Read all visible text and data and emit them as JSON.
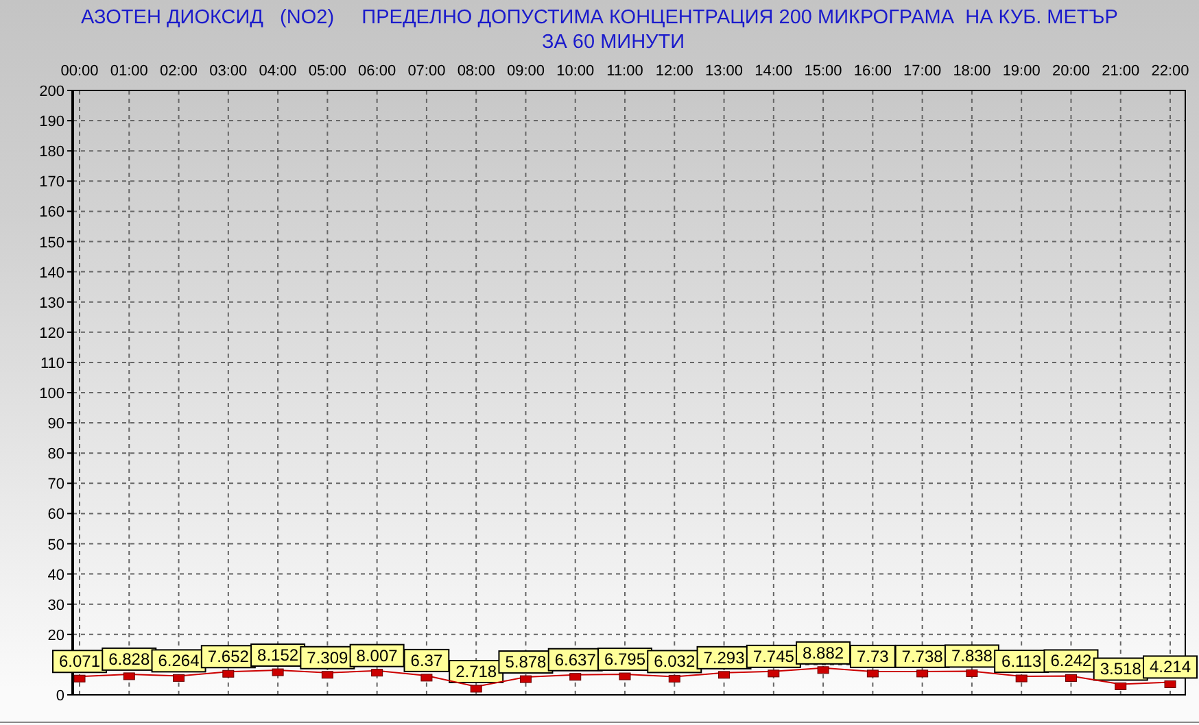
{
  "title": {
    "lines": [
      "АЗОТЕН ДИОКСИД   (NO2)     ПРЕДЕЛНО ДОПУСТИМА КОНЦЕНТРАЦИЯ 200 МИКРОГРАМА  НА КУБ. МЕТЪР",
      "ЗА 60 МИНУТИ"
    ]
  },
  "chart_data": {
    "type": "line",
    "categories": [
      "00:00",
      "01:00",
      "02:00",
      "03:00",
      "04:00",
      "05:00",
      "06:00",
      "07:00",
      "08:00",
      "09:00",
      "10:00",
      "11:00",
      "12:00",
      "13:00",
      "14:00",
      "15:00",
      "16:00",
      "17:00",
      "18:00",
      "19:00",
      "20:00",
      "21:00",
      "22:00"
    ],
    "series": [
      {
        "color": "#cc0000",
        "marker": "square",
        "values": [
          6.071,
          6.828,
          6.264,
          7.652,
          8.152,
          7.309,
          8.007,
          6.37,
          2.718,
          5.878,
          6.637,
          6.795,
          6.032,
          7.293,
          7.745,
          8.882,
          7.73,
          7.738,
          7.838,
          6.113,
          6.242,
          3.518,
          4.214
        ]
      }
    ],
    "ylim": [
      0,
      200
    ],
    "grid": true,
    "yticks": [
      0,
      20,
      30,
      40,
      50,
      60,
      70,
      80,
      90,
      100,
      110,
      120,
      130,
      140,
      150,
      160,
      170,
      180,
      190,
      200
    ],
    "value_labels": [
      "6.071",
      "6.828",
      "6.264",
      "7.652",
      "8.152",
      "7.309",
      "8.007",
      "6.37",
      "2.718",
      "5.878",
      "6.637",
      "6.795",
      "6.032",
      "7.293",
      "7.745",
      "8.882",
      "7.73",
      "7.738",
      "7.838",
      "6.113",
      "6.242",
      "3.518",
      "4.214"
    ]
  }
}
